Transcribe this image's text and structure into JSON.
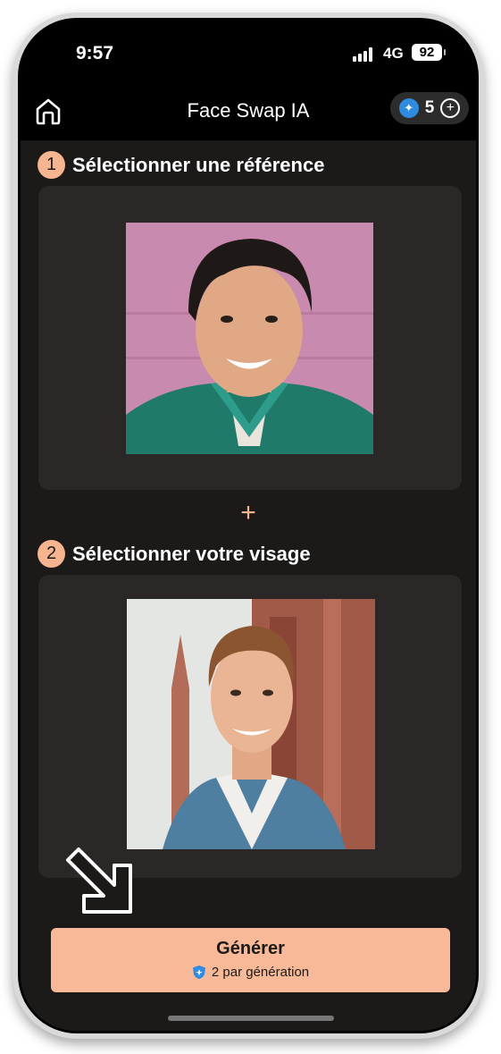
{
  "status_bar": {
    "time": "9:57",
    "network": "4G",
    "battery": "92"
  },
  "header": {
    "title": "Face Swap IA",
    "credits": "5"
  },
  "step1": {
    "number": "1",
    "title": "Sélectionner une référence"
  },
  "separator": "+",
  "step2": {
    "number": "2",
    "title": "Sélectionner votre visage"
  },
  "generate": {
    "label": "Générer",
    "cost": "2 par génération"
  },
  "colors": {
    "accent": "#f7b491",
    "background": "#1c1a19",
    "card": "#2a2726",
    "gem": "#2e8be0"
  },
  "icons": [
    "home-icon",
    "gem-icon",
    "plus-circle-icon",
    "shield-icon",
    "arrow-pointer-icon"
  ]
}
